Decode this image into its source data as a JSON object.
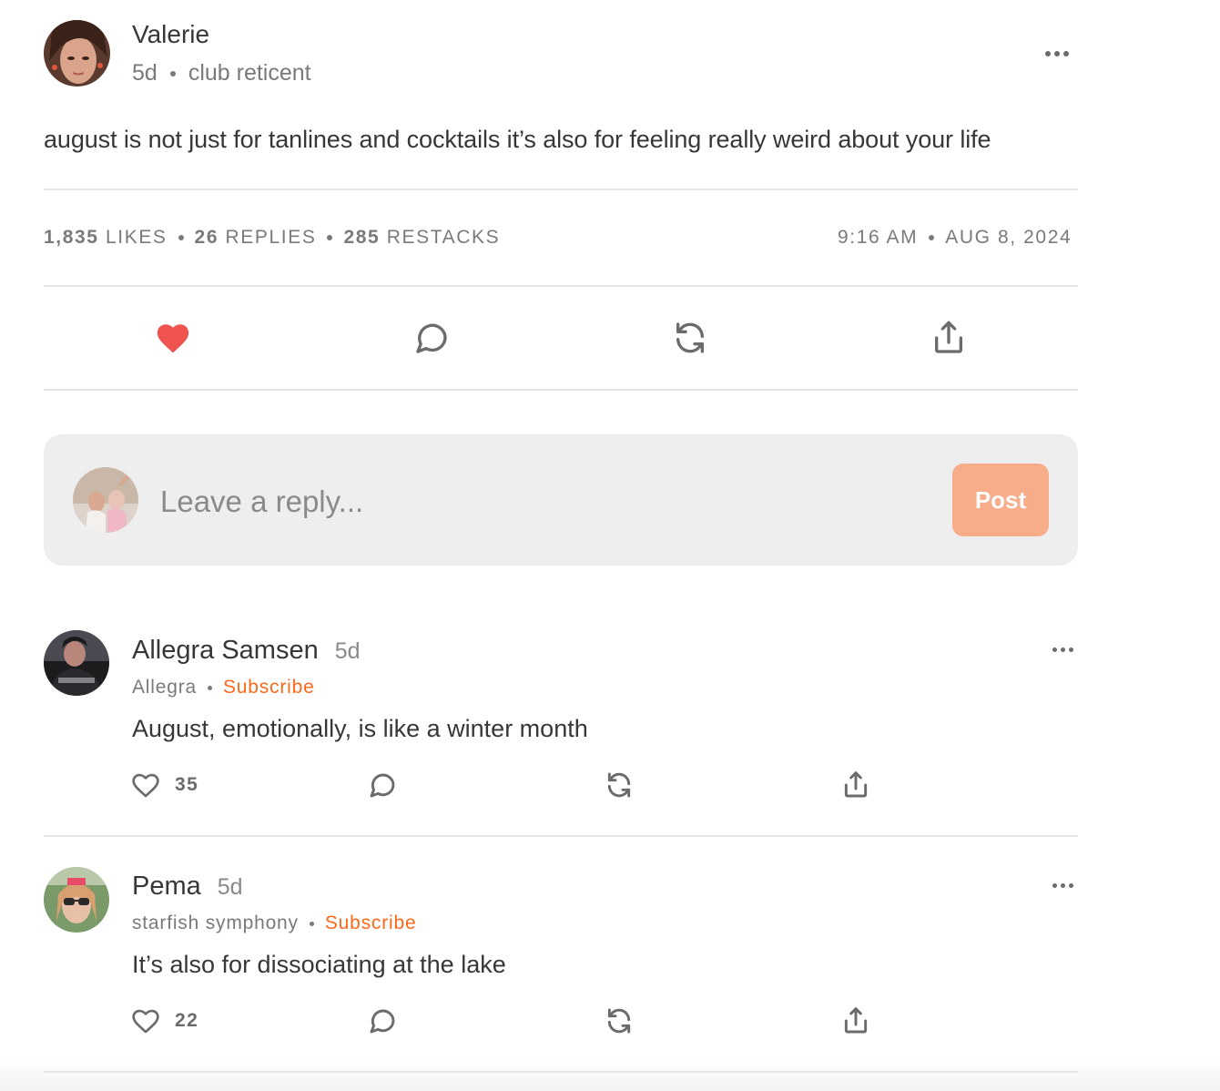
{
  "post": {
    "author": "Valerie",
    "age": "5d",
    "publication": "club reticent",
    "body": "august is not just for tanlines and cocktails it’s also for feeling really weird about your life",
    "stats": {
      "likes_count": "1,835",
      "likes_label": "LIKES",
      "replies_count": "26",
      "replies_label": "REPLIES",
      "restacks_count": "285",
      "restacks_label": "RESTACKS",
      "time": "9:16 AM",
      "date": "AUG 8, 2024"
    },
    "actions": {
      "like_icon": "heart-filled-icon",
      "reply_icon": "comment-bubble-icon",
      "restack_icon": "restack-icon",
      "share_icon": "share-icon"
    },
    "liked": true
  },
  "reply_box": {
    "placeholder": "Leave a reply...",
    "post_label": "Post"
  },
  "comments": [
    {
      "author": "Allegra Samsen",
      "age": "5d",
      "publication": "Allegra",
      "subscribe_label": "Subscribe",
      "body": "August, emotionally, is like a winter month",
      "likes": "35"
    },
    {
      "author": "Pema",
      "age": "5d",
      "publication": "starfish symphony",
      "subscribe_label": "Subscribe",
      "body": "It’s also for dissociating at the lake",
      "likes": "22"
    }
  ],
  "colors": {
    "heart": "#ef5350",
    "subscribe": "#ff6719",
    "post_button": "#f7ac8a",
    "reply_box_bg": "#eeeeee"
  }
}
